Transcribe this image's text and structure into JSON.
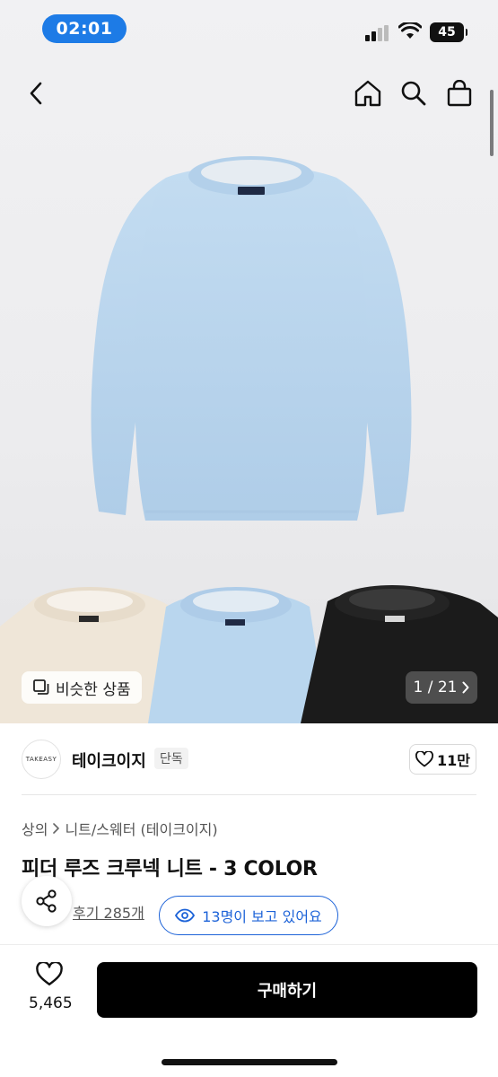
{
  "status_bar": {
    "time": "02:01",
    "battery": "45"
  },
  "gallery": {
    "similar_label": "비슷한 상품",
    "page_indicator": "1 / 21",
    "brand_tag": "TAKEASY"
  },
  "brand": {
    "logo_text": "TAKEASY",
    "name": "테이크이지",
    "badge": "단독",
    "likes": "11만"
  },
  "product": {
    "breadcrumb": [
      "상의",
      "니트/스웨터 (테이크이지)"
    ],
    "title": "피더 루즈 크루넥 니트 - 3 COLOR",
    "reviews": "후기 285개",
    "viewers": "13명이 보고 있어요"
  },
  "bottom_bar": {
    "wish_count": "5,465",
    "buy_label": "구매하기"
  },
  "colors": {
    "accent": "#1d63d8",
    "status_pill": "#1d7be6",
    "sweater_blue": "#b9d6ee",
    "sweater_cream": "#efe6d8",
    "sweater_black": "#1b1b1b"
  },
  "icons": [
    "back-icon",
    "home-icon",
    "search-icon",
    "bag-icon",
    "similar-icon",
    "chevron-right-icon",
    "heart-icon",
    "eye-icon",
    "share-icon"
  ]
}
